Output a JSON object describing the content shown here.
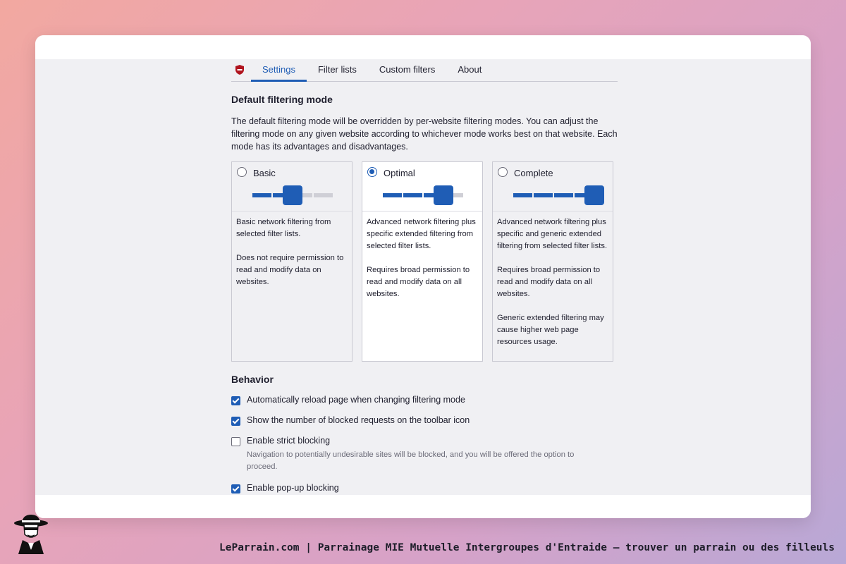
{
  "tabs": [
    {
      "label": "Settings",
      "active": true
    },
    {
      "label": "Filter lists",
      "active": false
    },
    {
      "label": "Custom filters",
      "active": false
    },
    {
      "label": "About",
      "active": false
    }
  ],
  "filtering": {
    "title": "Default filtering mode",
    "description": "The default filtering mode will be overridden by per-website filtering modes. You can adjust the filtering mode on any given website according to whichever mode works best on that website. Each mode has its advantages and disadvantages.",
    "selected": "Optimal",
    "modes": [
      {
        "label": "Basic",
        "level": 2,
        "p1": "Basic network filtering from selected filter lists.",
        "p2": "Does not require permission to read and modify data on websites.",
        "p3": ""
      },
      {
        "label": "Optimal",
        "level": 3,
        "p1": "Advanced network filtering plus specific extended filtering from selected filter lists.",
        "p2": "Requires broad permission to read and modify data on all websites.",
        "p3": ""
      },
      {
        "label": "Complete",
        "level": 4,
        "p1": "Advanced network filtering plus specific and generic extended filtering from selected filter lists.",
        "p2": "Requires broad permission to read and modify data on all websites.",
        "p3": "Generic extended filtering may cause higher web page resources usage."
      }
    ]
  },
  "behavior": {
    "title": "Behavior",
    "options": [
      {
        "label": "Automatically reload page when changing filtering mode",
        "checked": true,
        "sub": ""
      },
      {
        "label": "Show the number of blocked requests on the toolbar icon",
        "checked": true,
        "sub": ""
      },
      {
        "label": "Enable strict blocking",
        "checked": false,
        "sub": "Navigation to potentially undesirable sites will be blocked, and you will be offered the option to proceed."
      },
      {
        "label": "Enable pop-up blocking",
        "checked": true,
        "sub": ""
      }
    ]
  },
  "colors": {
    "accent": "#1f5db5",
    "shield": "#b0141e"
  },
  "footer": {
    "text": "LeParrain.com | Parrainage MIE Mutuelle Intergroupes d'Entraide — trouver un parrain ou des filleuls"
  }
}
